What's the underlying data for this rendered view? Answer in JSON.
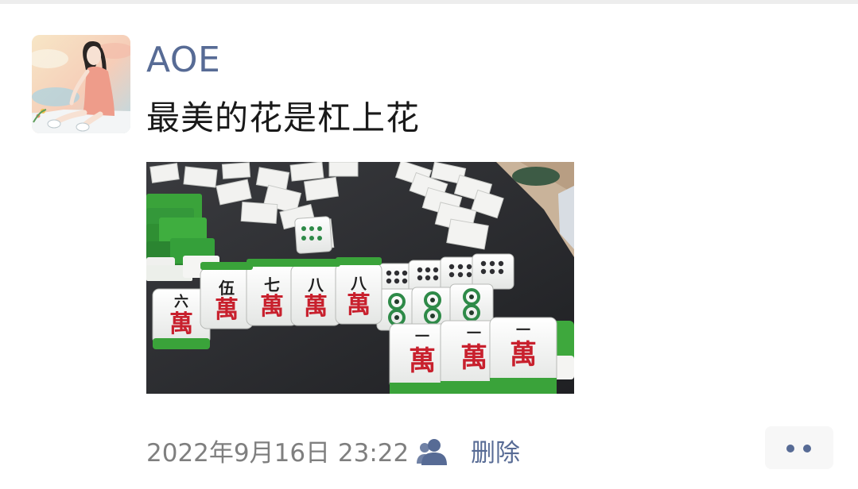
{
  "post": {
    "author": "AOE",
    "text": "最美的花是杠上花",
    "timestamp": "2022年9月16日 23:22",
    "delete_label": "删除"
  },
  "photo": {
    "tile_top_row": [
      "伍",
      "七",
      "八",
      "八"
    ],
    "tile_left": "六",
    "tile_wan": "萬",
    "tile_yi": "一"
  },
  "icons": {
    "privacy": "friends-icon",
    "more": "more-options-icon"
  },
  "colors": {
    "link": "#576b95",
    "text": "#191919",
    "meta": "#7f7f7f",
    "tile_red": "#c8202d",
    "tile_green": "#37a33a"
  }
}
